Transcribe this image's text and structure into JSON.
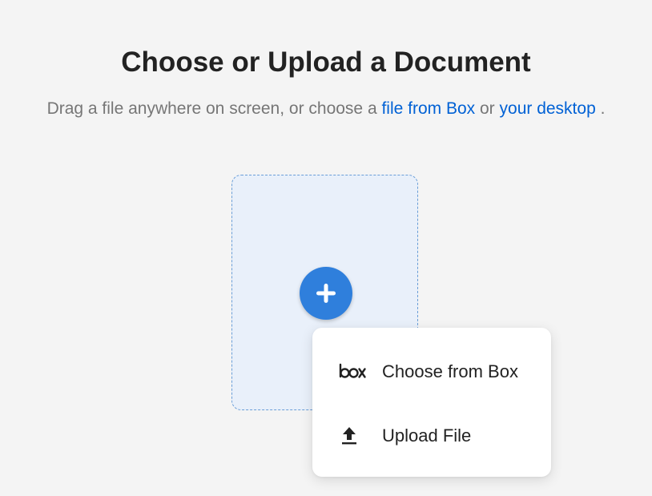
{
  "header": {
    "title": "Choose or Upload a Document",
    "subtitle_prefix": "Drag a file anywhere on screen, or choose a ",
    "link_box": "file from Box",
    "subtitle_middle": " or ",
    "link_desktop": "your desktop",
    "subtitle_suffix": " ."
  },
  "dropzone": {
    "add_icon": "plus-icon"
  },
  "menu": {
    "items": [
      {
        "label": "Choose from Box",
        "icon": "box-logo-icon"
      },
      {
        "label": "Upload File",
        "icon": "upload-icon"
      }
    ]
  },
  "colors": {
    "background": "#f4f4f4",
    "link": "#0061d5",
    "accent": "#2f7fdc",
    "dropzone_fill": "#e9f0fa",
    "dropzone_border": "#6a9ed8"
  }
}
